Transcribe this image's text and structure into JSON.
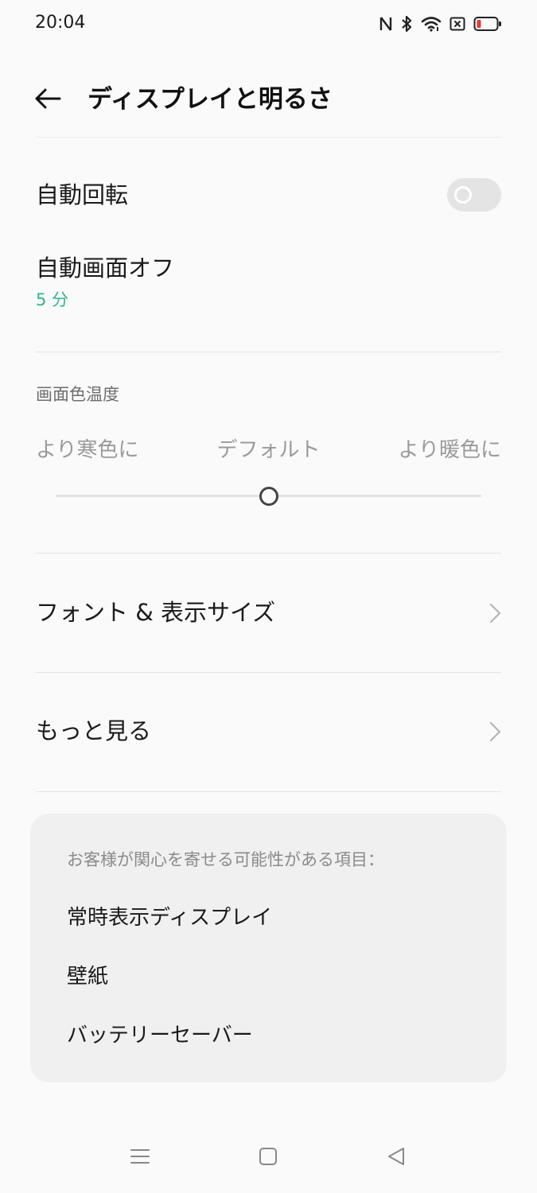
{
  "status_bar": {
    "time": "20:04",
    "icons": [
      "nfc-icon",
      "bluetooth-icon",
      "wifi-icon",
      "sim-off-icon",
      "battery-low-icon"
    ],
    "battery_color": "#e53935"
  },
  "header": {
    "back_icon": "arrow-left-icon",
    "title": "ディスプレイと明るさ"
  },
  "settings": {
    "auto_rotate": {
      "label": "自動回転",
      "enabled": false
    },
    "screen_timeout": {
      "label": "自動画面オフ",
      "value": "5 分"
    }
  },
  "color_temperature": {
    "title": "画面色温度",
    "cool_label": "より寒色に",
    "default_label": "デフォルト",
    "warm_label": "より暖色に",
    "value": 0.5
  },
  "nav_items": [
    {
      "label": "フォント & 表示サイズ",
      "icon": "chevron-right-icon"
    },
    {
      "label": "もっと見る",
      "icon": "chevron-right-icon"
    }
  ],
  "suggestions": {
    "title": "お客様が関心を寄せる可能性がある項目：",
    "items": [
      "常時表示ディスプレイ",
      "壁紙",
      "バッテリーセーバー"
    ]
  },
  "nav_bar": {
    "buttons": [
      "menu-icon",
      "home-icon",
      "back-triangle-icon"
    ]
  },
  "colors": {
    "accent_green": "#2fb48c",
    "background": "#fafafa",
    "card_background": "#f0f0f0"
  }
}
